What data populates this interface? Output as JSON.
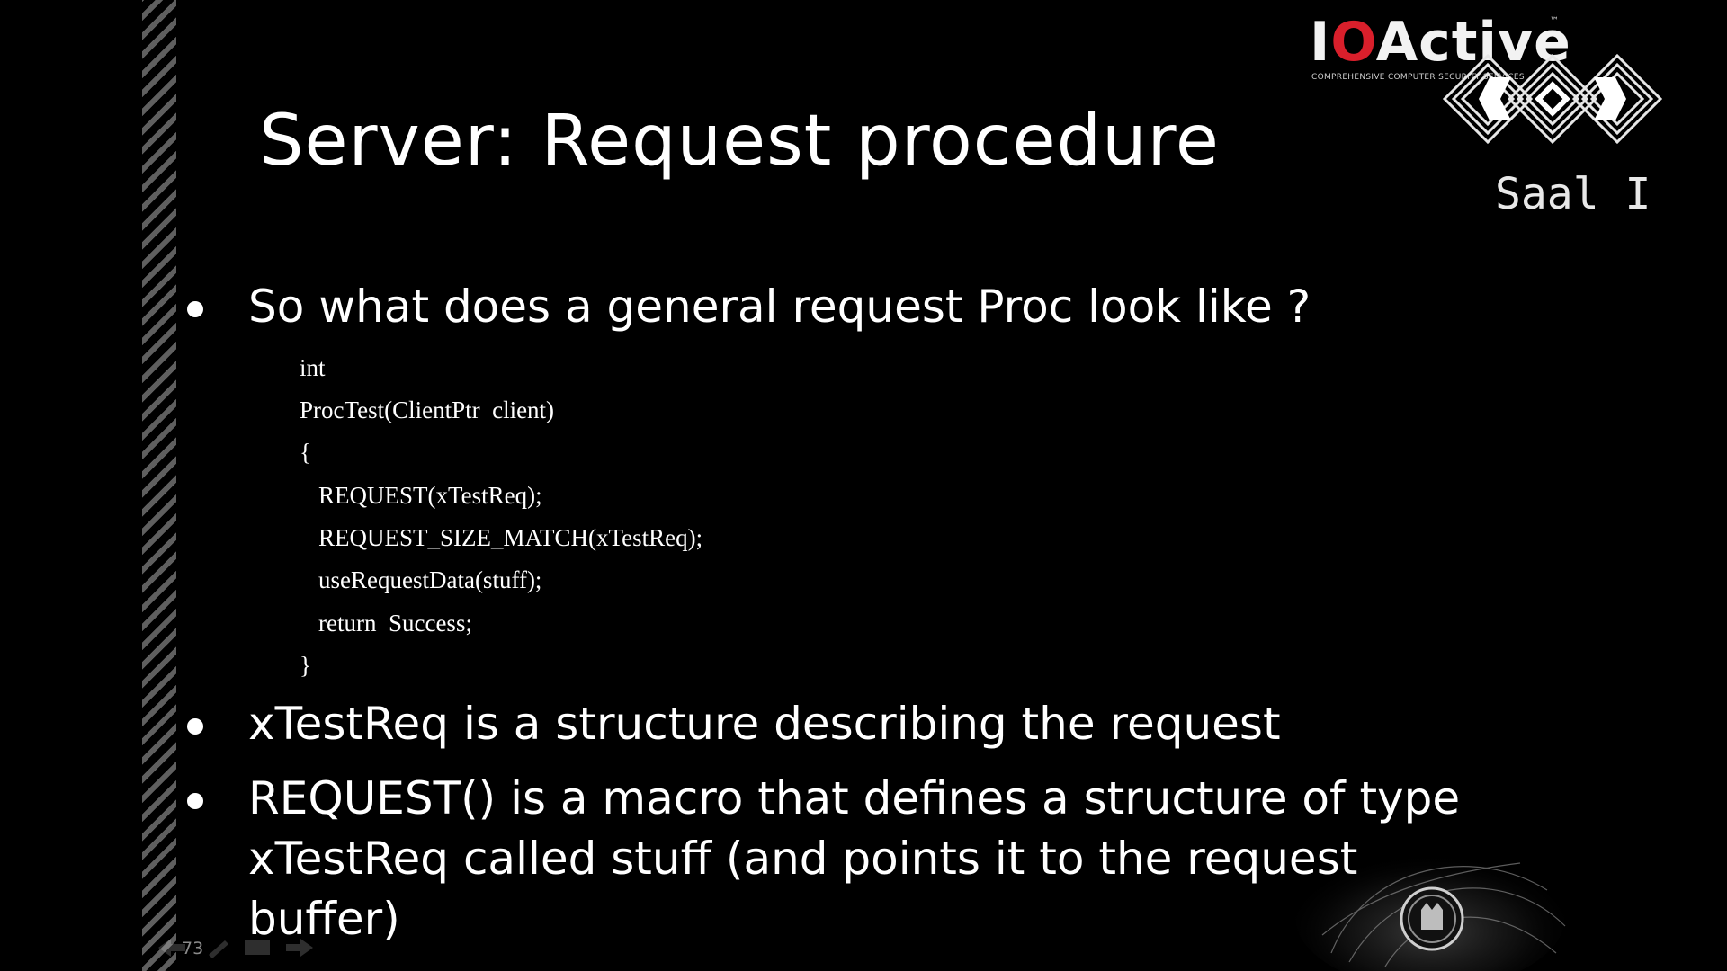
{
  "slide": {
    "title": "Server: Request procedure",
    "page_number": "73"
  },
  "logo": {
    "io": "I",
    "o": "O",
    "active": "Active",
    "tm": "™",
    "tagline": "COMPREHENSIVE COMPUTER SECURITY SERVICES"
  },
  "venue": {
    "saal": "Saal I"
  },
  "bullets": [
    {
      "text": "So what does a general request Proc look like ?"
    },
    {
      "text": "xTestReq is a structure describing the request"
    },
    {
      "text": "REQUEST() is a macro that defines a structure of type"
    },
    {
      "text": "xTestReq called stuff (and points it to the request"
    },
    {
      "text": "buffer)"
    }
  ],
  "code_lines": [
    "int",
    "ProcTest(ClientPtr  client)",
    "{",
    "REQUEST(xTestReq);",
    "REQUEST_SIZE_MATCH(xTestReq);",
    "useRequestData(stuff);",
    "return  Success;",
    "}"
  ],
  "colors": {
    "background": "#000000",
    "text": "#ffffff",
    "brand_red": "#d91f2b",
    "stripe": "#5f5f5f"
  },
  "icons": {
    "ccc_mark": "chaos-communication-congress-icon",
    "emblem": "emblem-icon",
    "nav": [
      "prev-slide-icon",
      "pen-icon",
      "menu-icon",
      "next-slide-icon"
    ]
  }
}
